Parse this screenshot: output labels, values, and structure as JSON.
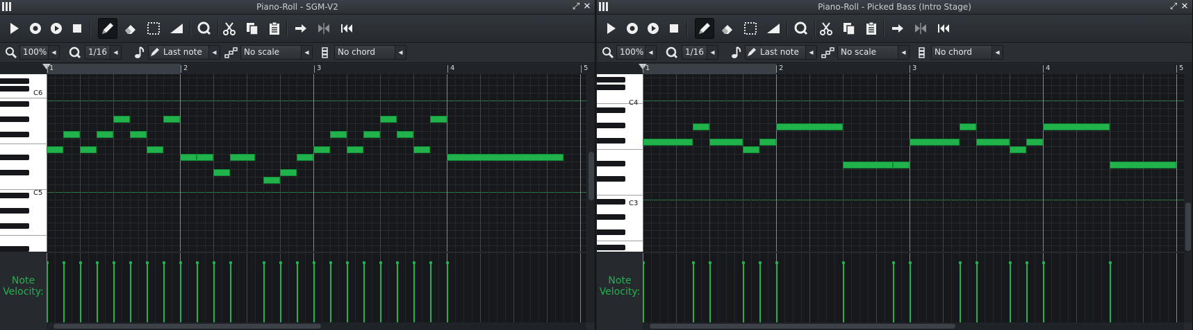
{
  "left": {
    "title": "Piano-Roll - SGM-V2",
    "zoom": "100%",
    "quantize": "1/16",
    "note_length": "Last note",
    "scale": "No scale",
    "chord": "No chord",
    "bars": [
      "1",
      "2",
      "3",
      "4",
      "5"
    ],
    "key_labels": [
      "C6",
      "C5"
    ],
    "velocity_label_line1": "Note",
    "velocity_label_line2": "Velocity:"
  },
  "right": {
    "title": "Piano-Roll - Picked Bass (Intro Stage)",
    "zoom": "100%",
    "quantize": "1/16",
    "note_length": "Last note",
    "scale": "No scale",
    "chord": "No chord",
    "bars": [
      "1",
      "2",
      "3",
      "4",
      "5"
    ],
    "key_labels": [
      "C4",
      "C3"
    ],
    "velocity_label_line1": "Note",
    "velocity_label_line2": "Velocity:"
  },
  "toolbar_icons": [
    "play-icon",
    "record-icon",
    "record-while-playing-icon",
    "stop-icon",
    "pencil-draw-icon",
    "eraser-icon",
    "select-icon",
    "pitch-bend-icon",
    "quantize-icon",
    "cut-icon",
    "copy-icon",
    "paste-icon",
    "stop-behavior-icon",
    "reverse-icon",
    "rewind-icon"
  ],
  "colors": {
    "note": "#22b24c",
    "background": "#16181b",
    "accent": "#22b24c"
  }
}
